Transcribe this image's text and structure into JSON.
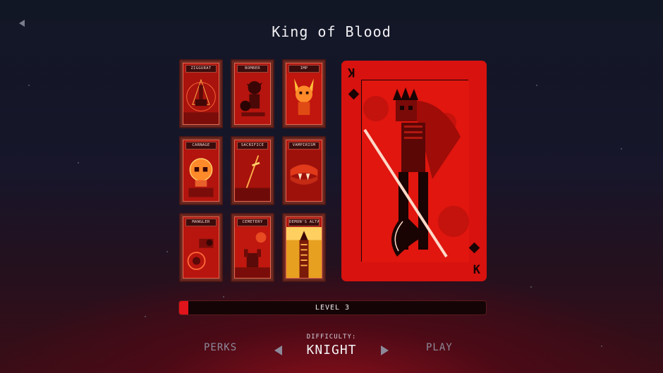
{
  "screen": {
    "title": "King of Blood",
    "back_icon": "back-arrow-icon"
  },
  "cards": [
    {
      "label": "ZIGGURAT",
      "art": "ziggurat-pyramid"
    },
    {
      "label": "BOMBER",
      "art": "goblin-bomber"
    },
    {
      "label": "IMP",
      "art": "horned-imp"
    },
    {
      "label": "CARNAGE",
      "art": "skull"
    },
    {
      "label": "SACRIFICE",
      "art": "dagger"
    },
    {
      "label": "VAMPIRISM",
      "art": "fanged-mouth"
    },
    {
      "label": "MANGLER",
      "art": "grinder"
    },
    {
      "label": "CEMETERY",
      "art": "grave-hand"
    },
    {
      "label": "DEMON'S ALTAR",
      "art": "altar-stairs"
    }
  ],
  "feature_card": {
    "rank": "K",
    "suit": "diamond",
    "art": "skeleton-king-with-scythe"
  },
  "level": {
    "label": "LEVEL 3",
    "progress": 0.03
  },
  "footer": {
    "perks_label": "PERKS",
    "difficulty_label": "DIFFICULTY:",
    "difficulty_value": "KNIGHT",
    "play_label": "PLAY"
  },
  "colors": {
    "accent": "#e0141a",
    "card_red": "#d8120f",
    "muted_text": "#8c8999"
  }
}
